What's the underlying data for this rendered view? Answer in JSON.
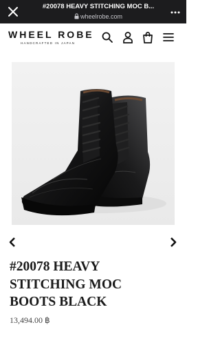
{
  "browser": {
    "title": "#20078 HEAVY STITCHING MOC B...",
    "url": "wheelrobe.com"
  },
  "site": {
    "logo_main": "WHEEL ROBE",
    "logo_sub": "HANDCRAFTED IN JAPAN"
  },
  "header_icons": [
    "search-icon",
    "account-icon",
    "cart-icon",
    "menu-icon"
  ],
  "product": {
    "title_line1": "#20078 HEAVY",
    "title_line2": "STITCHING MOC",
    "title_line3": "BOOTS BLACK",
    "price": "13,494.00 ฿",
    "image_alt": "black moc toe lace-up boots"
  },
  "colors": {
    "browser_bar": "#1c1c1e",
    "text": "#1a1a1a",
    "price": "#444444",
    "image_bg": "#f3f3f3"
  }
}
